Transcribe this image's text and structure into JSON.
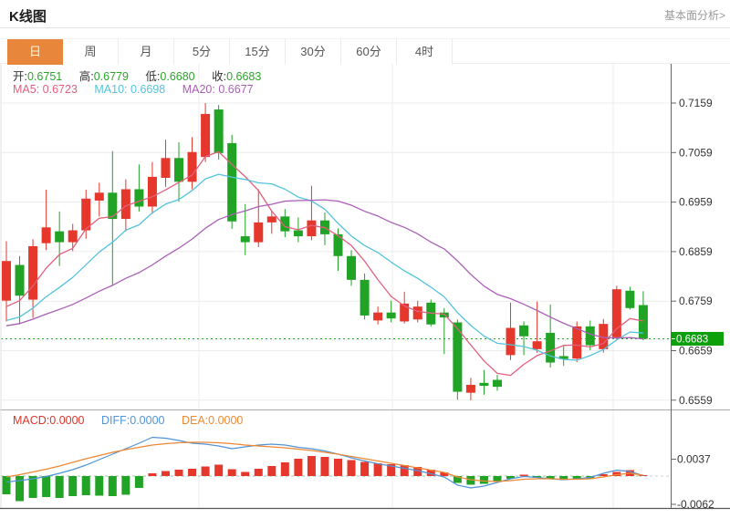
{
  "header": {
    "title": "K线图",
    "link_label": "基本面分析>"
  },
  "tabs": [
    {
      "key": "day",
      "label": "日",
      "active": true
    },
    {
      "key": "week",
      "label": "周",
      "active": false
    },
    {
      "key": "month",
      "label": "月",
      "active": false
    },
    {
      "key": "5min",
      "label": "5分",
      "active": false
    },
    {
      "key": "15min",
      "label": "15分",
      "active": false
    },
    {
      "key": "30min",
      "label": "30分",
      "active": false
    },
    {
      "key": "60min",
      "label": "60分",
      "active": false
    },
    {
      "key": "4hour",
      "label": "4时",
      "active": false
    }
  ],
  "legend": {
    "open_label": "开:",
    "open_value": "0.6751",
    "high_label": "高:",
    "high_value": "0.6779",
    "low_label": "低:",
    "low_value": "0.6680",
    "close_label": "收:",
    "close_value": "0.6683",
    "ma5_label": "MA5:",
    "ma5_value": "0.6723",
    "ma10_label": "MA10:",
    "ma10_value": "0.6698",
    "ma20_label": "MA20:",
    "ma20_value": "0.6677"
  },
  "macd_legend": {
    "macd_label": "MACD:",
    "macd_value": "0.0000",
    "diff_label": "DIFF:",
    "diff_value": "0.0000",
    "dea_label": "DEA:",
    "dea_value": "0.0000"
  },
  "colors": {
    "up": "#e5372c",
    "down": "#21a326",
    "price_badge": "#0ca00c",
    "ma5": "#e2607f",
    "ma10": "#54c3dc",
    "ma20": "#aa60b6",
    "diff": "#5094d6",
    "dea": "#ee8733",
    "current_price_line": "#2aa52a",
    "zero_dash": "#8fcf9e",
    "grid": "#ececec",
    "axis": "#666666",
    "tick_text": "#333333",
    "active_tab": "#e8863c"
  },
  "chart_data": [
    {
      "type": "candlestick",
      "name": "K线图 日线",
      "y_axis": {
        "ticks": [
          0.7159,
          0.7059,
          0.6959,
          0.6859,
          0.6759,
          0.6659,
          0.6559
        ],
        "current_price": 0.6683,
        "position": "right",
        "grid": true
      },
      "ohlc": {
        "open": 0.6751,
        "high": 0.6779,
        "low": 0.668,
        "close": 0.6683
      },
      "ma_values": {
        "MA5": 0.6723,
        "MA10": 0.6698,
        "MA20": 0.6677
      },
      "ma_periods": [
        5,
        10,
        20
      ],
      "ma_seed": [
        0.668,
        0.6695,
        0.67,
        0.669,
        0.67,
        0.671,
        0.67,
        0.669,
        0.67,
        0.672,
        0.67,
        0.669,
        0.668,
        0.669,
        0.67,
        0.671,
        0.672,
        0.673,
        0.674
      ],
      "candles": [
        [
          0.676,
          0.688,
          0.6718,
          0.684
        ],
        [
          0.6832,
          0.685,
          0.6712,
          0.677
        ],
        [
          0.6762,
          0.6884,
          0.6725,
          0.687
        ],
        [
          0.6876,
          0.6984,
          0.6862,
          0.6908
        ],
        [
          0.69,
          0.694,
          0.683,
          0.6878
        ],
        [
          0.6878,
          0.6915,
          0.686,
          0.6902
        ],
        [
          0.6902,
          0.6984,
          0.6885,
          0.6966
        ],
        [
          0.6962,
          0.6998,
          0.693,
          0.6978
        ],
        [
          0.6978,
          0.7062,
          0.679,
          0.6925
        ],
        [
          0.6925,
          0.7005,
          0.69,
          0.6985
        ],
        [
          0.6985,
          0.7035,
          0.694,
          0.695
        ],
        [
          0.695,
          0.704,
          0.6935,
          0.701
        ],
        [
          0.7008,
          0.7085,
          0.699,
          0.7048
        ],
        [
          0.7048,
          0.708,
          0.696,
          0.7
        ],
        [
          0.7,
          0.709,
          0.6985,
          0.706
        ],
        [
          0.705,
          0.7159,
          0.704,
          0.7137
        ],
        [
          0.7146,
          0.7155,
          0.7045,
          0.7058
        ],
        [
          0.7078,
          0.7095,
          0.6905,
          0.692
        ],
        [
          0.689,
          0.6955,
          0.6852,
          0.6878
        ],
        [
          0.6878,
          0.6985,
          0.6868,
          0.6918
        ],
        [
          0.6918,
          0.6942,
          0.6895,
          0.693
        ],
        [
          0.693,
          0.6945,
          0.6888,
          0.69
        ],
        [
          0.6902,
          0.6928,
          0.6878,
          0.689
        ],
        [
          0.689,
          0.6992,
          0.6882,
          0.6922
        ],
        [
          0.6922,
          0.6938,
          0.6872,
          0.6894
        ],
        [
          0.6894,
          0.6906,
          0.682,
          0.685
        ],
        [
          0.685,
          0.6862,
          0.679,
          0.6802
        ],
        [
          0.6802,
          0.6815,
          0.6722,
          0.673
        ],
        [
          0.672,
          0.6748,
          0.6712,
          0.6736
        ],
        [
          0.6736,
          0.676,
          0.6716,
          0.6724
        ],
        [
          0.6718,
          0.6778,
          0.6714,
          0.6754
        ],
        [
          0.6722,
          0.676,
          0.6716,
          0.6748
        ],
        [
          0.6756,
          0.6762,
          0.6708,
          0.6712
        ],
        [
          0.6736,
          0.6745,
          0.6652,
          0.6726
        ],
        [
          0.6716,
          0.6722,
          0.656,
          0.6576
        ],
        [
          0.6574,
          0.6604,
          0.6559,
          0.659
        ],
        [
          0.6594,
          0.662,
          0.657,
          0.6588
        ],
        [
          0.66,
          0.661,
          0.6578,
          0.6586
        ],
        [
          0.665,
          0.6756,
          0.664,
          0.6705
        ],
        [
          0.671,
          0.6718,
          0.665,
          0.6688
        ],
        [
          0.6662,
          0.6758,
          0.6655,
          0.6678
        ],
        [
          0.6695,
          0.6752,
          0.6625,
          0.6635
        ],
        [
          0.6648,
          0.6668,
          0.6628,
          0.6642
        ],
        [
          0.6643,
          0.6718,
          0.6636,
          0.6708
        ],
        [
          0.6708,
          0.672,
          0.666,
          0.667
        ],
        [
          0.6662,
          0.6723,
          0.6655,
          0.6713
        ],
        [
          0.6686,
          0.679,
          0.668,
          0.6783
        ],
        [
          0.678,
          0.6788,
          0.6742,
          0.6745
        ],
        [
          0.6751,
          0.6779,
          0.668,
          0.6683
        ]
      ]
    },
    {
      "type": "bar",
      "name": "MACD",
      "y_axis": {
        "ticks": [
          0.0037,
          -0.0062
        ],
        "zero_line": true,
        "position": "right"
      },
      "values": {
        "MACD": 0.0,
        "DIFF": 0.0,
        "DEA": 0.0
      },
      "histogram": [
        -0.004,
        -0.0055,
        -0.0048,
        -0.0046,
        -0.0048,
        -0.0044,
        -0.0042,
        -0.0043,
        -0.0044,
        -0.0041,
        -0.0026,
        0.0006,
        0.0011,
        0.0014,
        0.0016,
        0.0021,
        0.0025,
        0.0015,
        0.0009,
        0.0016,
        0.0022,
        0.003,
        0.0038,
        0.0044,
        0.0042,
        0.0038,
        0.0035,
        0.0031,
        0.0028,
        0.0026,
        0.0024,
        0.002,
        0.0014,
        0.0008,
        -0.0015,
        -0.0019,
        -0.0017,
        -0.0013,
        -0.0006,
        0.0003,
        -0.0004,
        -0.0007,
        -0.0009,
        -0.0008,
        -0.0005,
        0.0004,
        0.0009,
        0.0013,
        0.0002
      ],
      "series": [
        {
          "name": "DIFF",
          "values": [
            -0.0013,
            -0.001,
            -0.0006,
            -0.0001,
            0.0006,
            0.0014,
            0.0024,
            0.0036,
            0.0048,
            0.006,
            0.0072,
            0.0085,
            0.0083,
            0.0078,
            0.0072,
            0.007,
            0.0066,
            0.006,
            0.0064,
            0.0068,
            0.007,
            0.0068,
            0.0063,
            0.006,
            0.0055,
            0.0048,
            0.004,
            0.0033,
            0.0027,
            0.0022,
            0.0017,
            0.0012,
            0.0005,
            -0.0002,
            -0.002,
            -0.0026,
            -0.0022,
            -0.0014,
            -0.0006,
            -0.0001,
            -0.0003,
            -0.0006,
            -0.0008,
            -0.0006,
            -0.0003,
            0.0006,
            0.0013,
            0.001,
            0.0001
          ]
        },
        {
          "name": "DEA",
          "values": [
            -0.0002,
            0.0003,
            0.0009,
            0.0015,
            0.0022,
            0.003,
            0.0038,
            0.0045,
            0.0052,
            0.0058,
            0.0063,
            0.0068,
            0.0071,
            0.0073,
            0.0074,
            0.0074,
            0.0073,
            0.0071,
            0.0068,
            0.0066,
            0.0064,
            0.0062,
            0.0059,
            0.0056,
            0.0052,
            0.0048,
            0.0043,
            0.0038,
            0.0033,
            0.0028,
            0.0023,
            0.0018,
            0.0013,
            0.0008,
            -0.0002,
            -0.0008,
            -0.0011,
            -0.0012,
            -0.001,
            -0.0007,
            -0.0006,
            -0.0006,
            -0.0007,
            -0.0007,
            -0.0006,
            -0.0002,
            0.0003,
            0.0006,
            0.0002
          ]
        }
      ]
    }
  ]
}
